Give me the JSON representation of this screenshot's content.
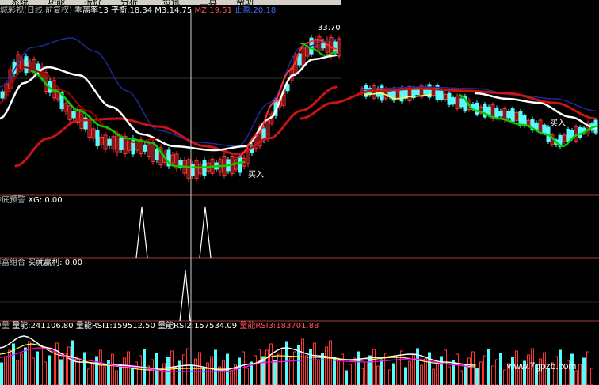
{
  "menubar": {
    "items": [
      "系统",
      "功能",
      "报价",
      "分析",
      "资讯",
      "工具",
      "帮助"
    ]
  },
  "main_panel": {
    "indicator_name": "长城彩视(日线 前复权)",
    "ratio_label": "乖离率13",
    "pingheng_label": "平衡:",
    "pingheng_value": "18.34",
    "m3_label": "M3:",
    "m3_value": "14.75",
    "mz_label": "MZ:",
    "mz_value": "19.51",
    "stop_label": "止盈:",
    "stop_value": "20.18",
    "high_price": "33.70",
    "buy_label_1": "买入",
    "buy_label_2": "买入"
  },
  "panel2": {
    "title": "抄底预警",
    "var": "XG:",
    "value": "0.00"
  },
  "panel3": {
    "title": "暴富组合",
    "var": "买就赢利:",
    "value": "0.00"
  },
  "panel4": {
    "title": "中量",
    "e1_label": "量能:",
    "e1_value": "241106.80",
    "e2_label": "量能RSI1:",
    "e2_value": "159512.50",
    "e3_label": "量能RSI2:",
    "e3_value": "157534.09",
    "e4_label": "量能RSI3:",
    "e4_value": "183701.88"
  },
  "watermark": "www.7gpzb.com",
  "colors": {
    "up": "#ff3232",
    "down": "#54fcfc",
    "white": "#ffffff",
    "green": "#00d000",
    "red_ma": "#c81414",
    "dark_red": "#a00000",
    "navy": "#1e2a9a",
    "yellow": "#ffff54",
    "magenta": "#ff00ff",
    "divider": "#a04040"
  }
}
